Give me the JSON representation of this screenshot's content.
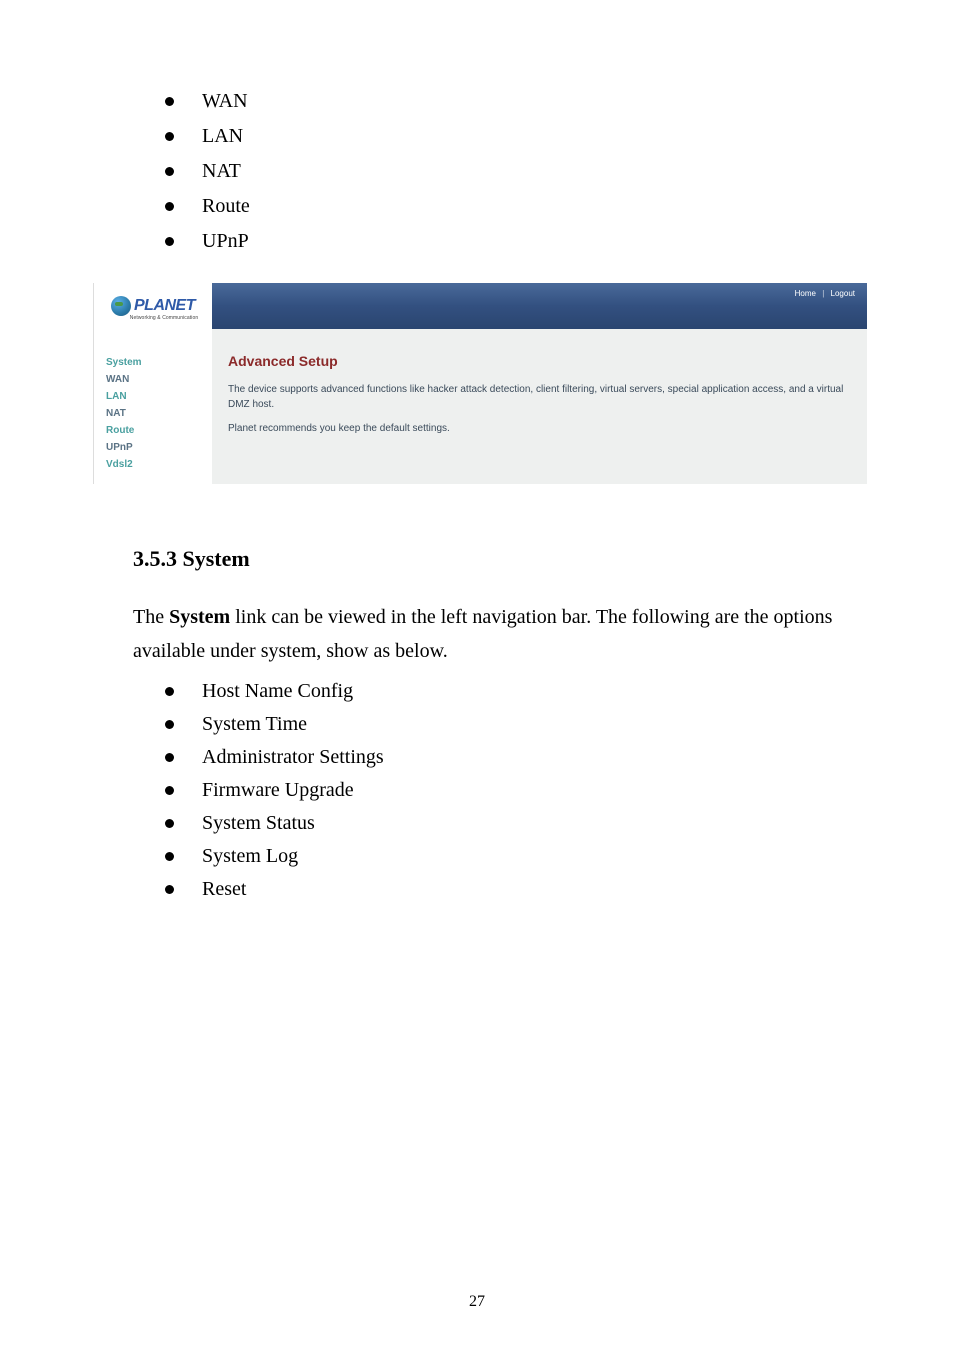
{
  "top_bullets": [
    "WAN",
    "LAN",
    "NAT",
    "Route",
    "UPnP"
  ],
  "screenshot": {
    "brand": "PLANET",
    "tagline": "Networking & Communication",
    "links": {
      "home": "Home",
      "logout": "Logout"
    },
    "sidebar": {
      "items": [
        {
          "label": "System",
          "cls": "c-teal"
        },
        {
          "label": "WAN",
          "cls": "c-slate"
        },
        {
          "label": "LAN",
          "cls": "c-teal"
        },
        {
          "label": "NAT",
          "cls": "c-slate"
        },
        {
          "label": "Route",
          "cls": "c-teal"
        },
        {
          "label": "UPnP",
          "cls": "c-slate"
        },
        {
          "label": "Vdsl2",
          "cls": "c-teal"
        }
      ]
    },
    "main": {
      "title": "Advanced Setup",
      "p1": "The device supports advanced functions like hacker attack detection, client filtering, virtual servers, special application access, and a virtual DMZ host.",
      "p2": "Planet recommends you keep the default settings."
    }
  },
  "section": {
    "heading": "3.5.3 System",
    "text_before_bold": "The ",
    "bold": "System",
    "text_after_bold": " link can be viewed in the left navigation bar. The following are the options available under system, show as below."
  },
  "bottom_bullets": [
    "Host Name Config",
    "System Time",
    "Administrator Settings",
    "Firmware Upgrade",
    "System Status",
    "System Log",
    "Reset"
  ],
  "page_number": "27"
}
